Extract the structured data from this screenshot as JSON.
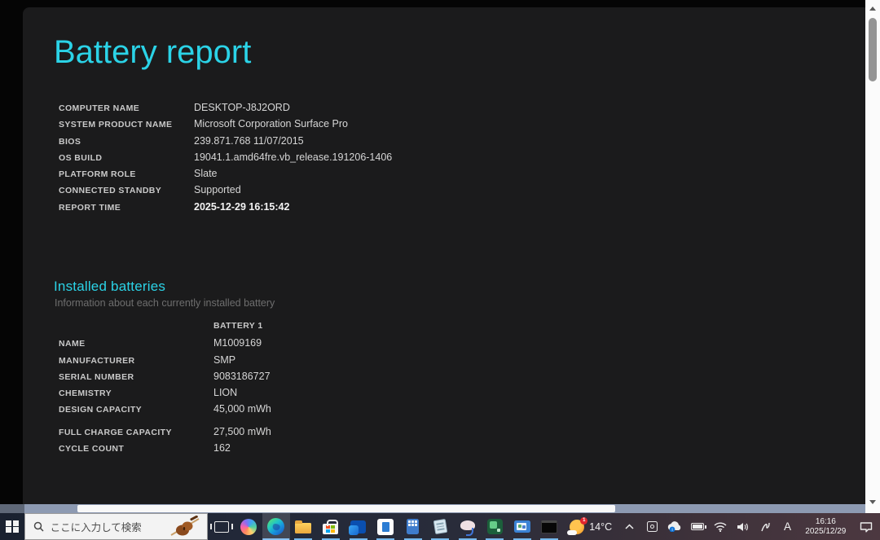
{
  "page": {
    "title": "Battery report",
    "system_info": [
      {
        "label": "COMPUTER NAME",
        "value": "DESKTOP-J8J2ORD"
      },
      {
        "label": "SYSTEM PRODUCT NAME",
        "value": "Microsoft Corporation Surface Pro"
      },
      {
        "label": "BIOS",
        "value": "239.871.768 11/07/2015"
      },
      {
        "label": "OS BUILD",
        "value": "19041.1.amd64fre.vb_release.191206-1406"
      },
      {
        "label": "PLATFORM ROLE",
        "value": "Slate"
      },
      {
        "label": "CONNECTED STANDBY",
        "value": "Supported"
      },
      {
        "label": "REPORT TIME",
        "value": "2025-12-29  16:15:42"
      }
    ],
    "batteries": {
      "heading": "Installed batteries",
      "subtitle": "Information about each currently installed battery",
      "column_header": "BATTERY 1",
      "rows": [
        {
          "label": "NAME",
          "value": "M1009169"
        },
        {
          "label": "MANUFACTURER",
          "value": "SMP"
        },
        {
          "label": "SERIAL NUMBER",
          "value": "9083186727"
        },
        {
          "label": "CHEMISTRY",
          "value": "LION"
        },
        {
          "label": "DESIGN CAPACITY",
          "value": "45,000 mWh"
        },
        {
          "label": "FULL CHARGE CAPACITY",
          "value": "27,500 mWh"
        },
        {
          "label": "CYCLE COUNT",
          "value": "162"
        }
      ]
    }
  },
  "taskbar": {
    "search": {
      "placeholder": "ここに入力して検索"
    },
    "pinned_icons": [
      "task-view",
      "copilot",
      "edge",
      "file-explorer",
      "microsoft-store",
      "outlook",
      "document-app",
      "calculator",
      "notepad",
      "cloud-app",
      "green-app",
      "media-app",
      "command-prompt"
    ],
    "weather": {
      "temp": "14°C"
    },
    "tray": {
      "ime": "A",
      "icons": [
        "hidden-icons-chevron",
        "meet-now",
        "onedrive",
        "battery",
        "wifi",
        "volume",
        "pen-ink",
        "ime-mode",
        "action-center"
      ]
    },
    "clock": {
      "time": "16:16",
      "date": "2025/12/29"
    }
  },
  "colors": {
    "accent_cyan": "#2bd3e7",
    "page_background": "#1b1b1c",
    "taskbar_left": "#1a2130",
    "taskbar_right": "#4c3840",
    "running_indicator": "#76b9ed",
    "badge_red": "#e0262e"
  }
}
